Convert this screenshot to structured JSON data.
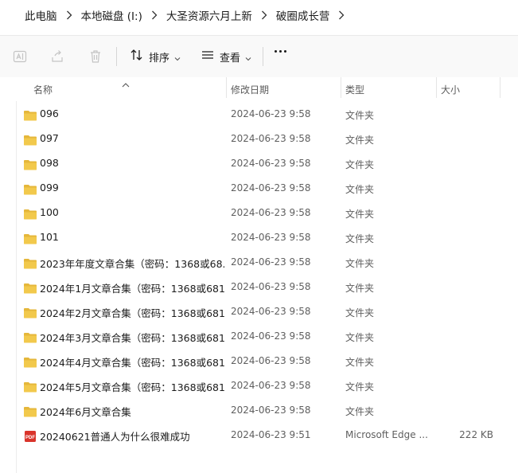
{
  "breadcrumb": [
    "此电脑",
    "本地磁盘 (I:)",
    "大圣资源六月上新",
    "破圈成长营"
  ],
  "toolbar": {
    "sort_label": "排序",
    "view_label": "查看"
  },
  "columns": {
    "name": "名称",
    "date": "修改日期",
    "type": "类型",
    "size": "大小"
  },
  "files": [
    {
      "name": "096",
      "date": "2024-06-23 9:58",
      "type": "文件夹",
      "size": "",
      "kind": "folder"
    },
    {
      "name": "097",
      "date": "2024-06-23 9:58",
      "type": "文件夹",
      "size": "",
      "kind": "folder"
    },
    {
      "name": "098",
      "date": "2024-06-23 9:58",
      "type": "文件夹",
      "size": "",
      "kind": "folder"
    },
    {
      "name": "099",
      "date": "2024-06-23 9:58",
      "type": "文件夹",
      "size": "",
      "kind": "folder"
    },
    {
      "name": "100",
      "date": "2024-06-23 9:58",
      "type": "文件夹",
      "size": "",
      "kind": "folder"
    },
    {
      "name": "101",
      "date": "2024-06-23 9:58",
      "type": "文件夹",
      "size": "",
      "kind": "folder"
    },
    {
      "name": "2023年年度文章合集（密码：1368或68...",
      "date": "2024-06-23 9:58",
      "type": "文件夹",
      "size": "",
      "kind": "folder"
    },
    {
      "name": "2024年1月文章合集（密码：1368或681...",
      "date": "2024-06-23 9:58",
      "type": "文件夹",
      "size": "",
      "kind": "folder"
    },
    {
      "name": "2024年2月文章合集（密码：1368或681...",
      "date": "2024-06-23 9:58",
      "type": "文件夹",
      "size": "",
      "kind": "folder"
    },
    {
      "name": "2024年3月文章合集（密码：1368或681...",
      "date": "2024-06-23 9:58",
      "type": "文件夹",
      "size": "",
      "kind": "folder"
    },
    {
      "name": "2024年4月文章合集（密码：1368或681...",
      "date": "2024-06-23 9:58",
      "type": "文件夹",
      "size": "",
      "kind": "folder"
    },
    {
      "name": "2024年5月文章合集（密码：1368或681...",
      "date": "2024-06-23 9:58",
      "type": "文件夹",
      "size": "",
      "kind": "folder"
    },
    {
      "name": "2024年6月文章合集",
      "date": "2024-06-23 9:58",
      "type": "文件夹",
      "size": "",
      "kind": "folder"
    },
    {
      "name": "20240621普通人为什么很难成功",
      "date": "2024-06-23 9:51",
      "type": "Microsoft Edge ...",
      "size": "222 KB",
      "kind": "pdf"
    }
  ],
  "icons": {
    "folder_color": "#f2c94c",
    "pdf_color": "#d9342b"
  }
}
